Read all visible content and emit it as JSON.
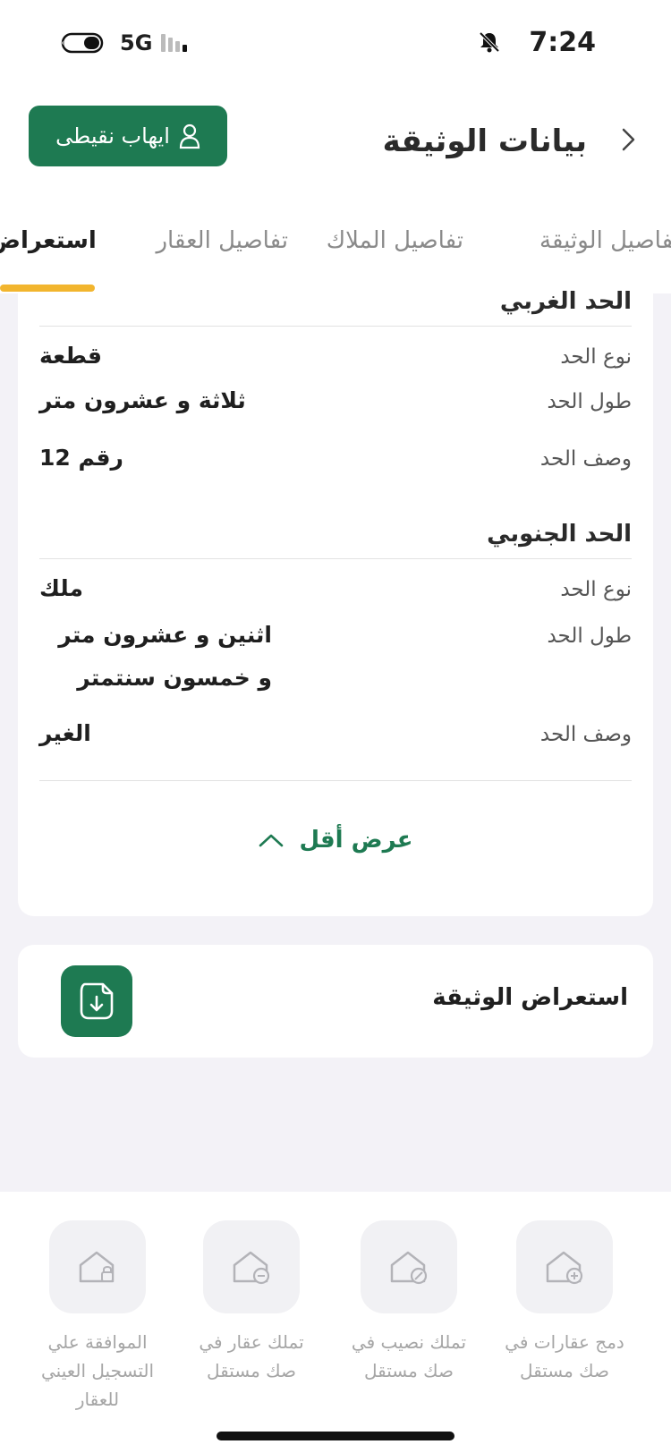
{
  "status": {
    "time": "7:24",
    "network": "5G"
  },
  "header": {
    "title": "بيانات الوثيقة",
    "user_name": "ايهاب نقيطى"
  },
  "tabs": [
    {
      "label": "تفاصيل الوثيقة"
    },
    {
      "label": "تفاصيل الملاك"
    },
    {
      "label": "تفاصيل العقار"
    },
    {
      "label": "استعراض"
    }
  ],
  "west_border": {
    "title": "الحد الغربي",
    "type_label": "نوع الحد",
    "type_value": "قطعة",
    "length_label": "طول الحد",
    "length_value": "ثلاثة و عشرون متر",
    "desc_label": "وصف الحد",
    "desc_value": "رقم 12"
  },
  "south_border": {
    "title": "الحد الجنوبي",
    "type_label": "نوع الحد",
    "type_value": "ملك",
    "length_label": "طول الحد",
    "length_value": "اثنين و عشرون متر و خمسون سنتمتر",
    "desc_label": "وصف الحد",
    "desc_value": "الغير"
  },
  "show_less_label": "عرض أقل",
  "document_view_label": "استعراض الوثيقة",
  "actions": [
    {
      "label": "دمج عقارات في\nصك مستقل",
      "icon": "house-plus-icon"
    },
    {
      "label": "تملك نصيب في\nصك مستقل",
      "icon": "house-percent-icon"
    },
    {
      "label": "تملك عقار في\nصك مستقل",
      "icon": "house-minus-icon"
    },
    {
      "label": "الموافقة علي\nالتسجيل العيني\nللعقار",
      "icon": "house-lock-icon"
    }
  ],
  "colors": {
    "primary": "#1e7a52",
    "accent": "#f2b52e"
  }
}
